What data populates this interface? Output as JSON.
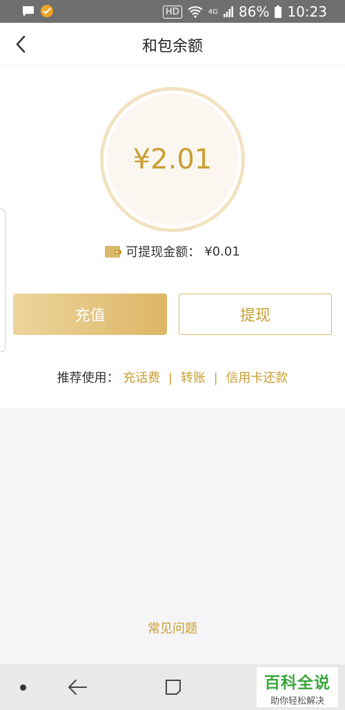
{
  "status_bar": {
    "hd": "HD",
    "network": "4G",
    "battery": "86%",
    "time": "10:23"
  },
  "header": {
    "title": "和包余额"
  },
  "balance": {
    "amount": "¥2.01",
    "withdrawable_label": "可提现金额：",
    "withdrawable_value": "¥0.01"
  },
  "actions": {
    "recharge": "充值",
    "withdraw": "提现"
  },
  "recommend": {
    "label": "推荐使用：",
    "links": [
      "充话费",
      "转账",
      "信用卡还款"
    ],
    "separator": "|"
  },
  "footer": {
    "faq": "常见问题"
  },
  "watermark": {
    "top": "百科全说",
    "bottom": "助你轻松解决"
  },
  "colors": {
    "accent": "#c99e32",
    "button_gradient_start": "#edd59d",
    "button_gradient_end": "#dcb665"
  }
}
